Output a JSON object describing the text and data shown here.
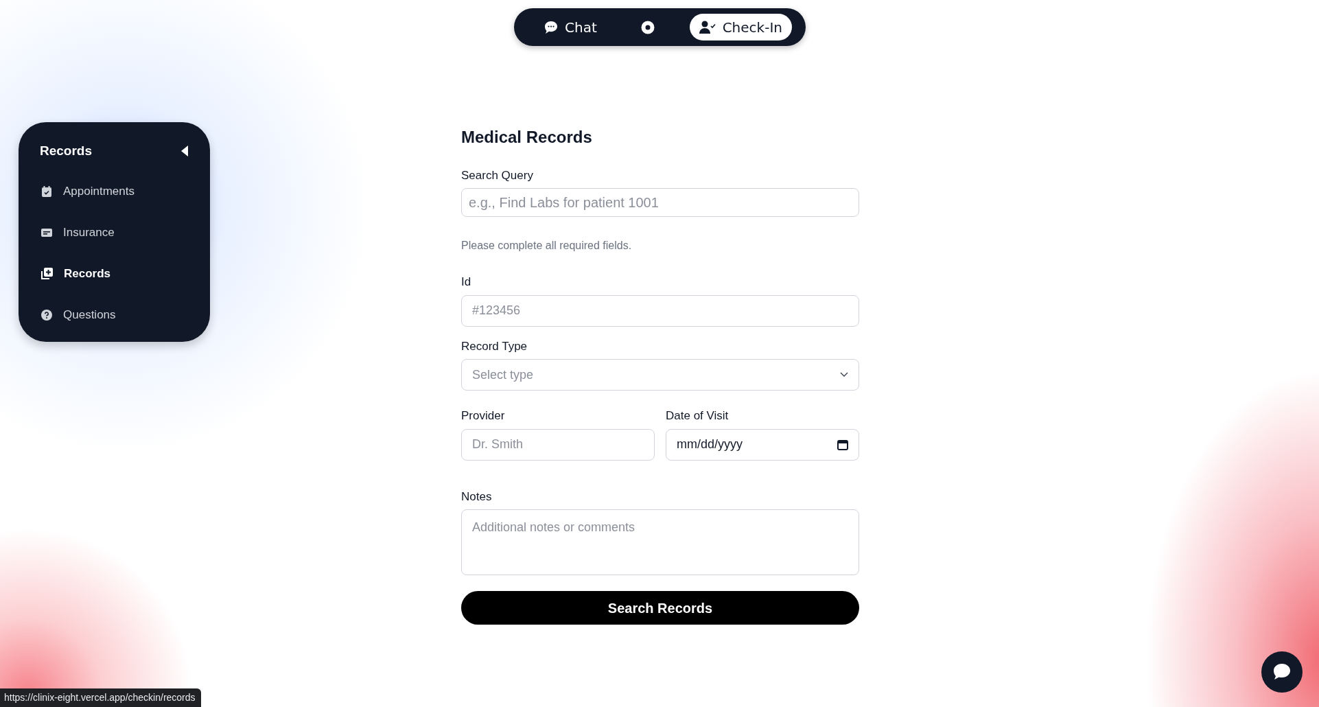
{
  "nav": {
    "items": [
      {
        "kind": "chat",
        "label": "Chat",
        "selected": false
      },
      {
        "kind": "dot",
        "selected": false
      },
      {
        "kind": "checkin",
        "label": "Check-In",
        "selected": true
      }
    ]
  },
  "sidebar": {
    "title": "Records",
    "items": [
      {
        "label": "Appointments",
        "selected": false
      },
      {
        "label": "Insurance",
        "selected": false
      },
      {
        "label": "Records",
        "selected": true
      },
      {
        "label": "Questions",
        "selected": false
      }
    ]
  },
  "form": {
    "title": "Medical Records",
    "search": {
      "label": "Search Query",
      "placeholder": "e.g., Find Labs for patient 1001"
    },
    "helper": "Please complete all required fields.",
    "fields": [
      {
        "kind": "text",
        "label": "Id",
        "placeholder": "#123456"
      },
      {
        "kind": "select",
        "label": "Record Type",
        "placeholder": "Select type"
      },
      {
        "kind": "pair",
        "items": [
          {
            "kind": "text",
            "label": "Provider",
            "placeholder": "Dr. Smith"
          },
          {
            "kind": "date",
            "label": "Date of Visit",
            "value": "mm/dd/yyyy"
          }
        ]
      },
      {
        "kind": "textarea",
        "label": "Notes",
        "placeholder": "Additional notes or comments"
      }
    ],
    "submit": "Search Records"
  },
  "status_bar": {
    "url": "https://clinix-eight.vercel.app/checkin/records"
  }
}
